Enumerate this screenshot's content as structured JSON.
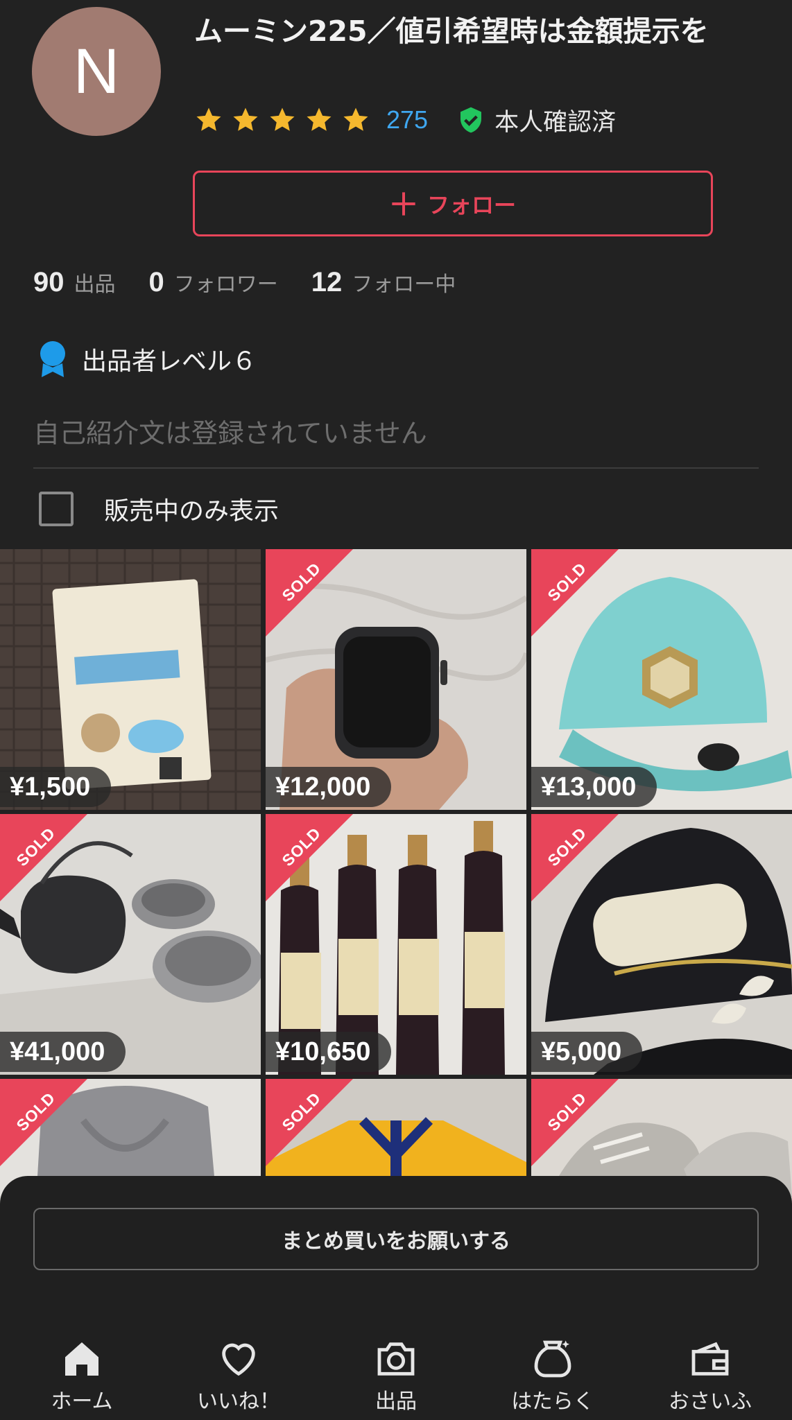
{
  "profile": {
    "avatar_letter": "N",
    "name": "ムーミン225／値引希望時は金額提示を",
    "rating_count": "275",
    "rating_stars": 5,
    "verified_label": "本人確認済",
    "follow_label": "フォロー",
    "stats": [
      {
        "num": "90",
        "label": "出品"
      },
      {
        "num": "0",
        "label": "フォロワー"
      },
      {
        "num": "12",
        "label": "フォロー中"
      }
    ],
    "level_label": "出品者レベル６",
    "bio": "自己紹介文は登録されていません",
    "filter_label": "販売中のみ表示"
  },
  "items": [
    {
      "price": "¥1,500",
      "sold": false
    },
    {
      "price": "¥12,000",
      "sold": true
    },
    {
      "price": "¥13,000",
      "sold": true
    },
    {
      "price": "¥41,000",
      "sold": true
    },
    {
      "price": "¥10,650",
      "sold": true
    },
    {
      "price": "¥5,000",
      "sold": true
    },
    {
      "price": "",
      "sold": true
    },
    {
      "price": "",
      "sold": true
    },
    {
      "price": "",
      "sold": true
    }
  ],
  "sold_label": "SOLD",
  "bulk_button_label": "まとめ買いをお願いする",
  "nav": [
    {
      "label": "ホーム",
      "icon": "home-icon"
    },
    {
      "label": "いいね！",
      "icon": "heart-icon"
    },
    {
      "label": "出品",
      "icon": "camera-icon"
    },
    {
      "label": "はたらく",
      "icon": "bag-icon"
    },
    {
      "label": "おさいふ",
      "icon": "wallet-icon"
    }
  ],
  "colors": {
    "background": "#222222",
    "accent": "#e8455a",
    "star": "#f5b82e",
    "link": "#3fa7f0",
    "verified": "#22c55e",
    "level": "#1e9be9"
  }
}
